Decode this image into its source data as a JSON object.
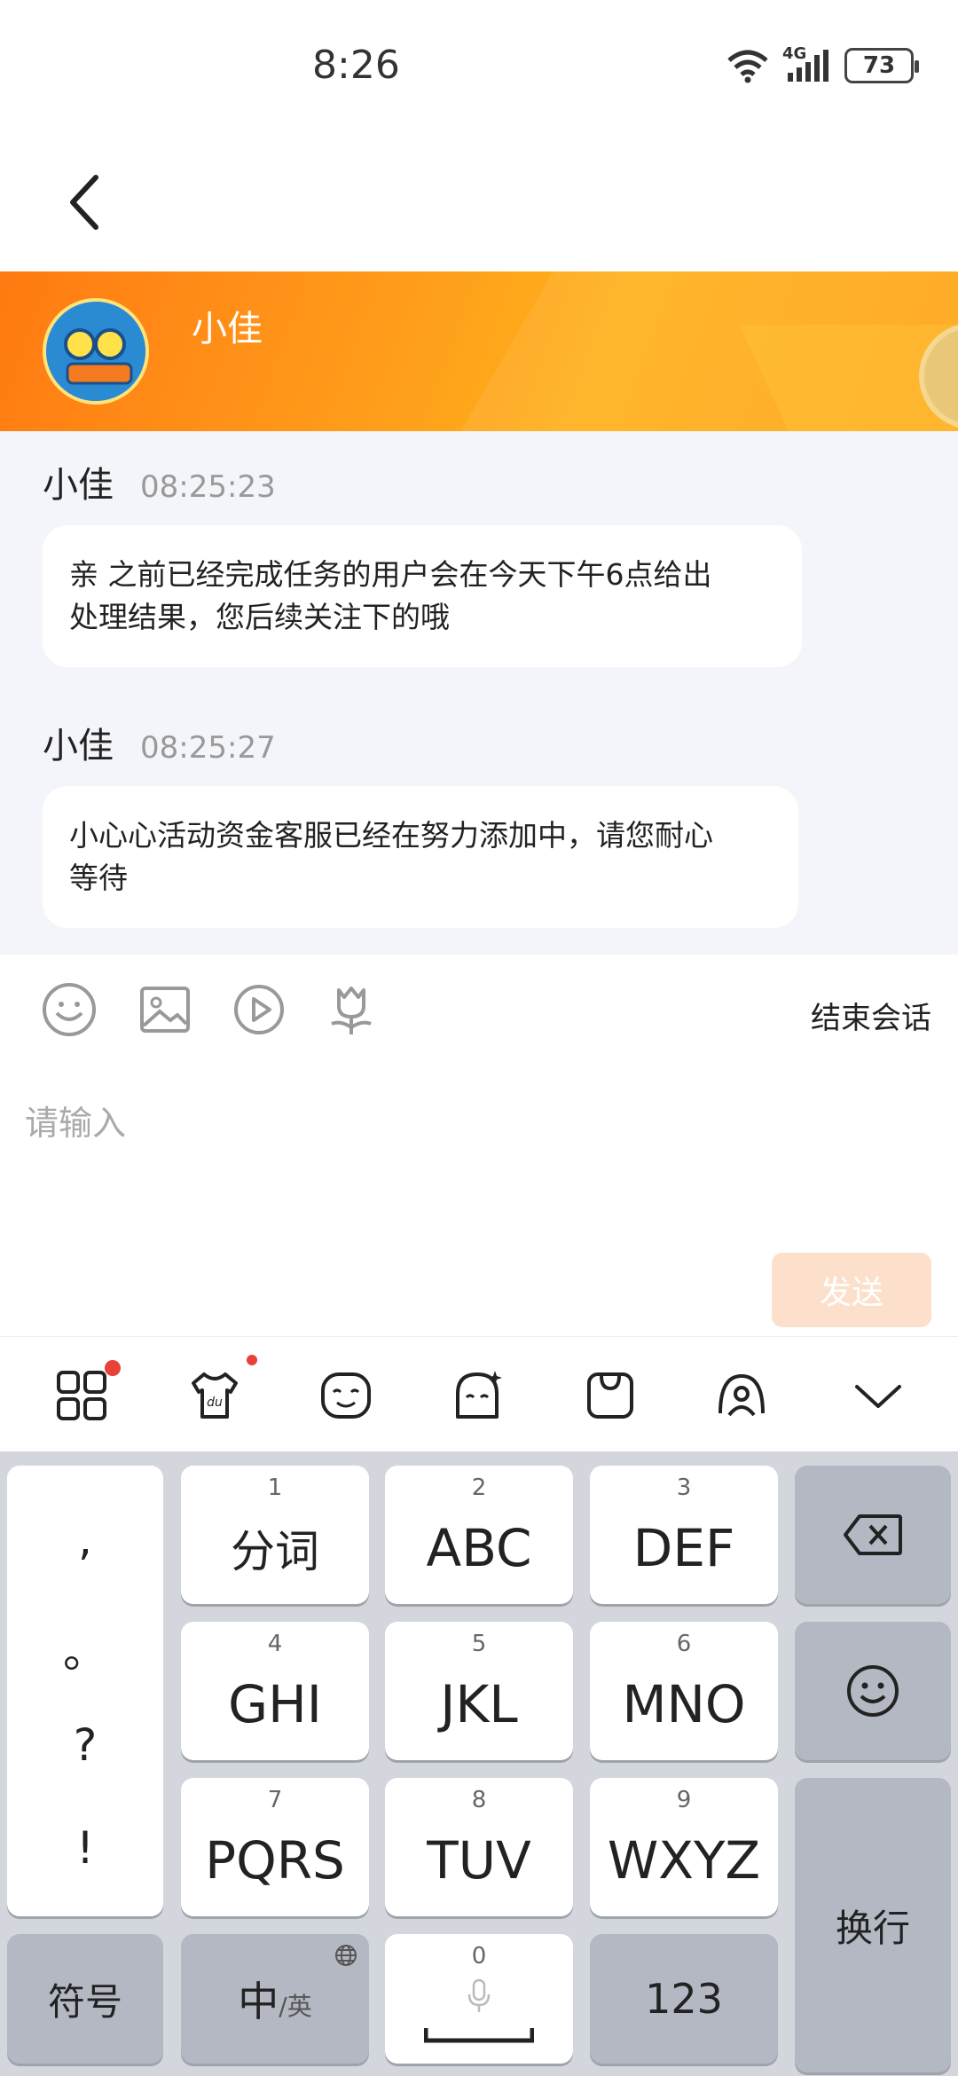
{
  "status_bar": {
    "time": "8:26",
    "network": "4G",
    "battery": "73"
  },
  "agent": {
    "name": "小佳"
  },
  "messages": [
    {
      "sender": "小佳",
      "time": "08:25:23",
      "line1": "亲  之前已经完成任务的用户会在今天下午6点给出",
      "line2": "处理结果，您后续关注下的哦"
    },
    {
      "sender": "小佳",
      "time": "08:25:27",
      "line1": "小心心活动资金客服已经在努力添加中，请您耐心",
      "line2": "等待"
    }
  ],
  "toolbar": {
    "end_session": "结束会话"
  },
  "input": {
    "placeholder": "请输入",
    "send_label": "发送"
  },
  "keyboard": {
    "punctuation": [
      ",",
      "。",
      "?",
      "!"
    ],
    "rows": [
      [
        {
          "num": "1",
          "label": "分词"
        },
        {
          "num": "2",
          "label": "ABC"
        },
        {
          "num": "3",
          "label": "DEF"
        }
      ],
      [
        {
          "num": "4",
          "label": "GHI"
        },
        {
          "num": "5",
          "label": "JKL"
        },
        {
          "num": "6",
          "label": "MNO"
        }
      ],
      [
        {
          "num": "7",
          "label": "PQRS"
        },
        {
          "num": "8",
          "label": "TUV"
        },
        {
          "num": "9",
          "label": "WXYZ"
        }
      ]
    ],
    "symbols": "符号",
    "lang_main": "中",
    "lang_alt": "/英",
    "space_num": "0",
    "numbers": "123",
    "enter": "换行"
  }
}
